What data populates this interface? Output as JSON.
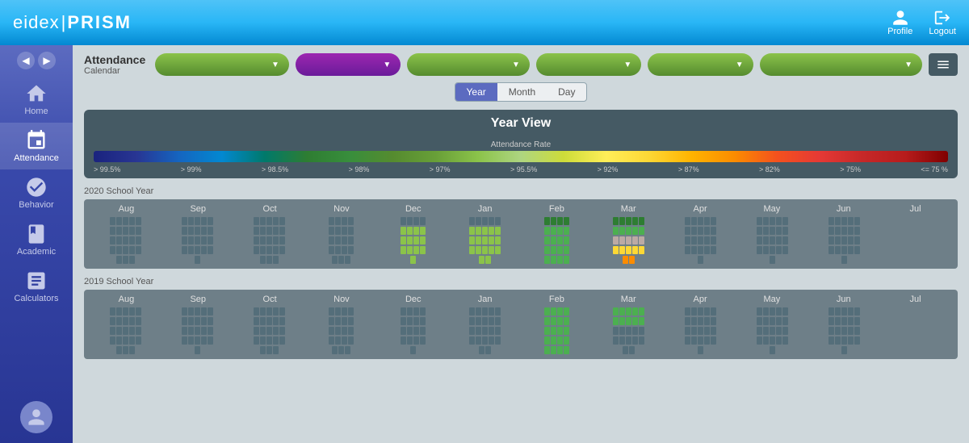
{
  "app": {
    "name_part1": "eidex",
    "name_separator": "|",
    "name_part2": "PRISM"
  },
  "topbar": {
    "profile_label": "Profile",
    "logout_label": "Logout"
  },
  "sidebar": {
    "nav_back": "◀",
    "nav_forward": "▶",
    "items": [
      {
        "id": "home",
        "label": "Home",
        "active": false
      },
      {
        "id": "attendance",
        "label": "Attendance",
        "active": true
      },
      {
        "id": "behavior",
        "label": "Behavior",
        "active": false
      },
      {
        "id": "academic",
        "label": "Academic",
        "active": false
      },
      {
        "id": "calculators",
        "label": "Calculators",
        "active": false
      }
    ]
  },
  "toolbar": {
    "title": "Attendance",
    "subtitle": "Calendar",
    "dropdowns": [
      {
        "id": "dd1",
        "label": "",
        "style": "green"
      },
      {
        "id": "dd2",
        "label": "",
        "style": "purple"
      },
      {
        "id": "dd3",
        "label": "",
        "style": "green2"
      },
      {
        "id": "dd4",
        "label": "",
        "style": "green3"
      },
      {
        "id": "dd5",
        "label": "",
        "style": "green4"
      },
      {
        "id": "dd6",
        "label": "",
        "style": "green5"
      }
    ]
  },
  "view_toggle": {
    "buttons": [
      {
        "id": "year",
        "label": "Year",
        "active": true
      },
      {
        "id": "month",
        "label": "Month",
        "active": false
      },
      {
        "id": "day",
        "label": "Day",
        "active": false
      }
    ]
  },
  "year_view": {
    "title": "Year View",
    "attendance_rate_label": "Attendance Rate",
    "rate_labels": [
      "> 99.5%",
      "> 99%",
      "> 98.5%",
      "> 98%",
      "> 97%",
      "> 95.5%",
      "> 92%",
      "> 87%",
      "> 82%",
      "> 75%",
      "<= 75 %"
    ]
  },
  "calendar_2020": {
    "label": "2020 School Year",
    "months": [
      "Aug",
      "Sep",
      "Oct",
      "Nov",
      "Dec",
      "Jan",
      "Feb",
      "Mar",
      "Apr",
      "May",
      "Jun",
      "Jul"
    ]
  },
  "calendar_2019": {
    "label": "2019 School Year",
    "months": [
      "Aug",
      "Sep",
      "Oct",
      "Nov",
      "Dec",
      "Jan",
      "Feb",
      "Mar",
      "Apr",
      "May",
      "Jun",
      "Jul"
    ]
  }
}
